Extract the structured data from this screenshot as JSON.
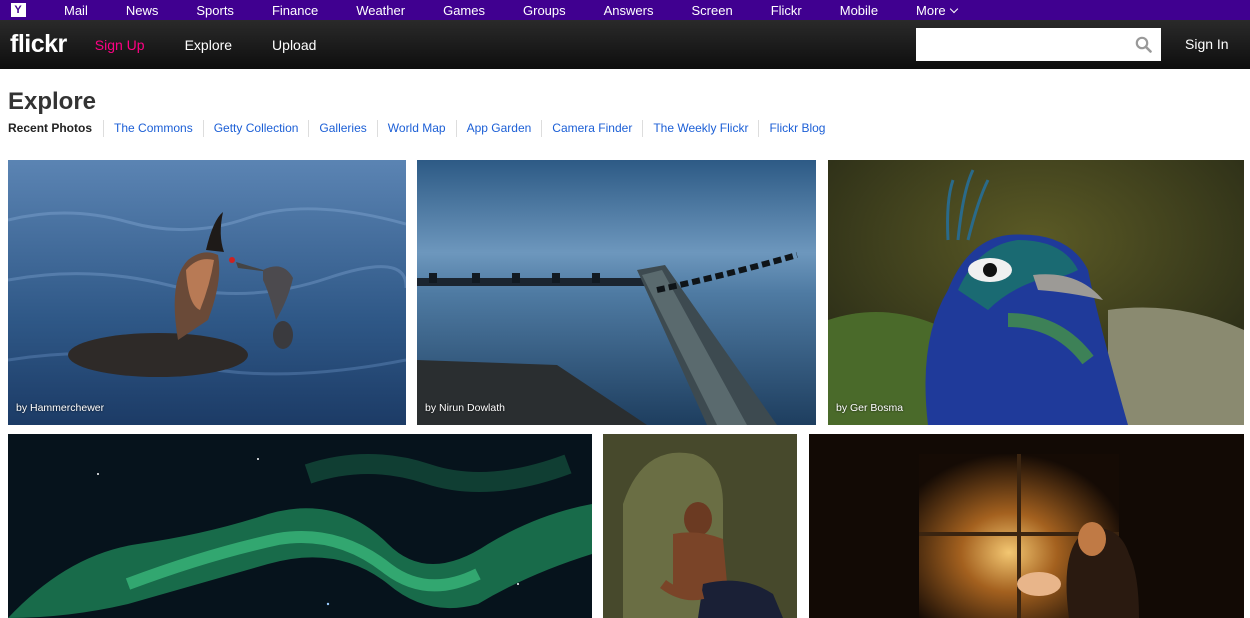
{
  "yahoo_bar": {
    "logo": "Y",
    "links": [
      "Mail",
      "News",
      "Sports",
      "Finance",
      "Weather",
      "Games",
      "Groups",
      "Answers",
      "Screen",
      "Flickr",
      "Mobile"
    ],
    "more_label": "More"
  },
  "header": {
    "logo": "flickr",
    "nav": [
      {
        "label": "Sign Up"
      },
      {
        "label": "Explore"
      },
      {
        "label": "Upload"
      }
    ],
    "search": {
      "value": "",
      "placeholder": ""
    },
    "signin_label": "Sign In"
  },
  "explore": {
    "title": "Explore",
    "tabs": [
      {
        "label": "Recent Photos",
        "active": true
      },
      {
        "label": "The Commons"
      },
      {
        "label": "Getty Collection"
      },
      {
        "label": "Galleries"
      },
      {
        "label": "World Map"
      },
      {
        "label": "App Garden"
      },
      {
        "label": "Camera Finder"
      },
      {
        "label": "The Weekly Flickr"
      },
      {
        "label": "Flickr Blog"
      }
    ]
  },
  "photos": [
    {
      "credit": "by Hammerchewer",
      "subject": "grebe-with-fish"
    },
    {
      "credit": "by Nirun Dowlath",
      "subject": "seascape-pool-long-exposure"
    },
    {
      "credit": "by Ger Bosma",
      "subject": "peacock-portrait"
    },
    {
      "credit": "",
      "subject": "aurora-borealis"
    },
    {
      "credit": "",
      "subject": "smiling-boy"
    },
    {
      "credit": "",
      "subject": "father-and-baby-by-window"
    }
  ],
  "colors": {
    "yahoo_purple": "#400090",
    "flickr_pink": "#ff0084",
    "link_blue": "#1c5fd6"
  }
}
